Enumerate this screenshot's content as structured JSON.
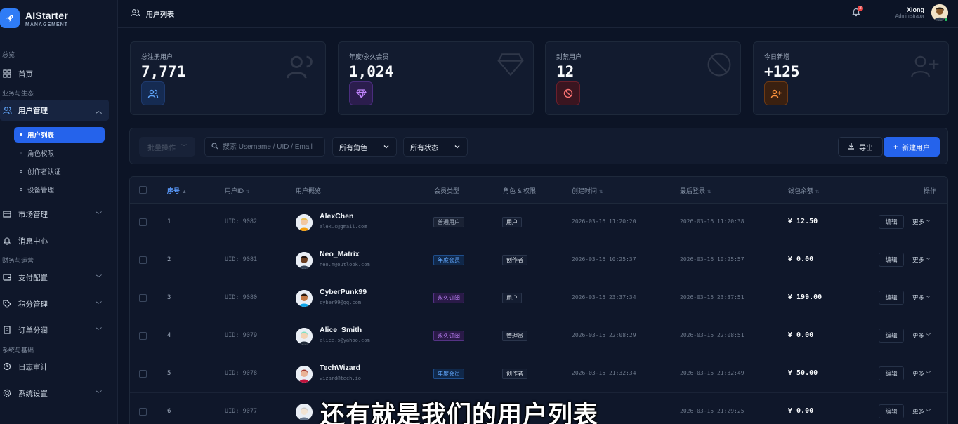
{
  "brand": {
    "title": "AIStarter",
    "subtitle": "MANAGEMENT"
  },
  "sidebar": {
    "sections": [
      "总览",
      "业务与生态",
      "财务与运营",
      "系统与基础"
    ],
    "items": [
      {
        "label": "首页",
        "icon": "grid-icon"
      },
      {
        "label": "用户管理",
        "icon": "users-icon",
        "expanded": true
      },
      {
        "label": "市场管理",
        "icon": "store-icon"
      },
      {
        "label": "消息中心",
        "icon": "bell-icon"
      },
      {
        "label": "支付配置",
        "icon": "wallet-icon"
      },
      {
        "label": "积分管理",
        "icon": "tag-icon"
      },
      {
        "label": "订单分润",
        "icon": "receipt-icon"
      },
      {
        "label": "日志审计",
        "icon": "history-icon"
      },
      {
        "label": "系统设置",
        "icon": "gear-icon"
      }
    ],
    "user_submenu": [
      "用户列表",
      "角色权限",
      "创作者认证",
      "设备管理"
    ],
    "active_sub": "用户列表"
  },
  "header": {
    "title": "用户列表",
    "notification_count": "2",
    "user_name": "Xiong",
    "user_role": "Administrator"
  },
  "stats": [
    {
      "label": "总注册用户",
      "value": "7,771",
      "icon": "users-icon",
      "color": "#3b82f6"
    },
    {
      "label": "年度/永久会员",
      "value": "1,024",
      "icon": "diamond-icon",
      "color": "#a855f7"
    },
    {
      "label": "封禁用户",
      "value": "12",
      "icon": "ban-icon",
      "color": "#ef4444"
    },
    {
      "label": "今日新增",
      "value": "+125",
      "icon": "user-plus-icon",
      "color": "#f97316"
    }
  ],
  "toolbar": {
    "batch_label": "批量操作",
    "search_placeholder": "搜索 Username / UID / Email",
    "role_filter": "所有角色",
    "status_filter": "所有状态",
    "export_label": "导出",
    "new_user_label": "新建用户"
  },
  "table": {
    "headers": {
      "index": "序号",
      "uid": "用户ID",
      "profile": "用户概览",
      "member": "会员类型",
      "role": "角色 & 权限",
      "created": "创建时间",
      "last_login": "最后登录",
      "wallet": "钱包余额",
      "actions": "操作"
    },
    "edit_label": "编辑",
    "more_label": "更多",
    "rows": [
      {
        "index": "1",
        "uid": "UID: 9082",
        "name": "AlexChen",
        "email": "alex.c@gmail.com",
        "member": "普通用户",
        "member_type": "normal",
        "role": "用户",
        "created": "2026-03-16 11:20:20",
        "last_login": "2026-03-16 11:20:38",
        "wallet": "¥ 12.50"
      },
      {
        "index": "2",
        "uid": "UID: 9081",
        "name": "Neo_Matrix",
        "email": "neo.m@outlook.com",
        "member": "年度会员",
        "member_type": "yearly",
        "role": "创作者",
        "created": "2026-03-16 10:25:37",
        "last_login": "2026-03-16 10:25:57",
        "wallet": "¥ 0.00"
      },
      {
        "index": "3",
        "uid": "UID: 9080",
        "name": "CyberPunk99",
        "email": "cyber99@qq.com",
        "member": "永久订阅",
        "member_type": "lifetime",
        "role": "用户",
        "created": "2026-03-15 23:37:34",
        "last_login": "2026-03-15 23:37:51",
        "wallet": "¥ 199.00"
      },
      {
        "index": "4",
        "uid": "UID: 9079",
        "name": "Alice_Smith",
        "email": "alice.s@yahoo.com",
        "member": "永久订阅",
        "member_type": "lifetime",
        "role": "管理员",
        "created": "2026-03-15 22:08:29",
        "last_login": "2026-03-15 22:08:51",
        "wallet": "¥ 0.00"
      },
      {
        "index": "5",
        "uid": "UID: 9078",
        "name": "TechWizard",
        "email": "wizard@tech.io",
        "member": "年度会员",
        "member_type": "yearly",
        "role": "创作者",
        "created": "2026-03-15 21:32:34",
        "last_login": "2026-03-15 21:32:49",
        "wallet": "¥ 50.00"
      },
      {
        "index": "6",
        "uid": "UID: 9077",
        "name": "",
        "email": "",
        "member": "",
        "member_type": "",
        "role": "",
        "created": "",
        "last_login": "2026-03-15 21:29:25",
        "wallet": "¥ 0.00"
      }
    ]
  },
  "caption": "还有就是我们的用户列表"
}
